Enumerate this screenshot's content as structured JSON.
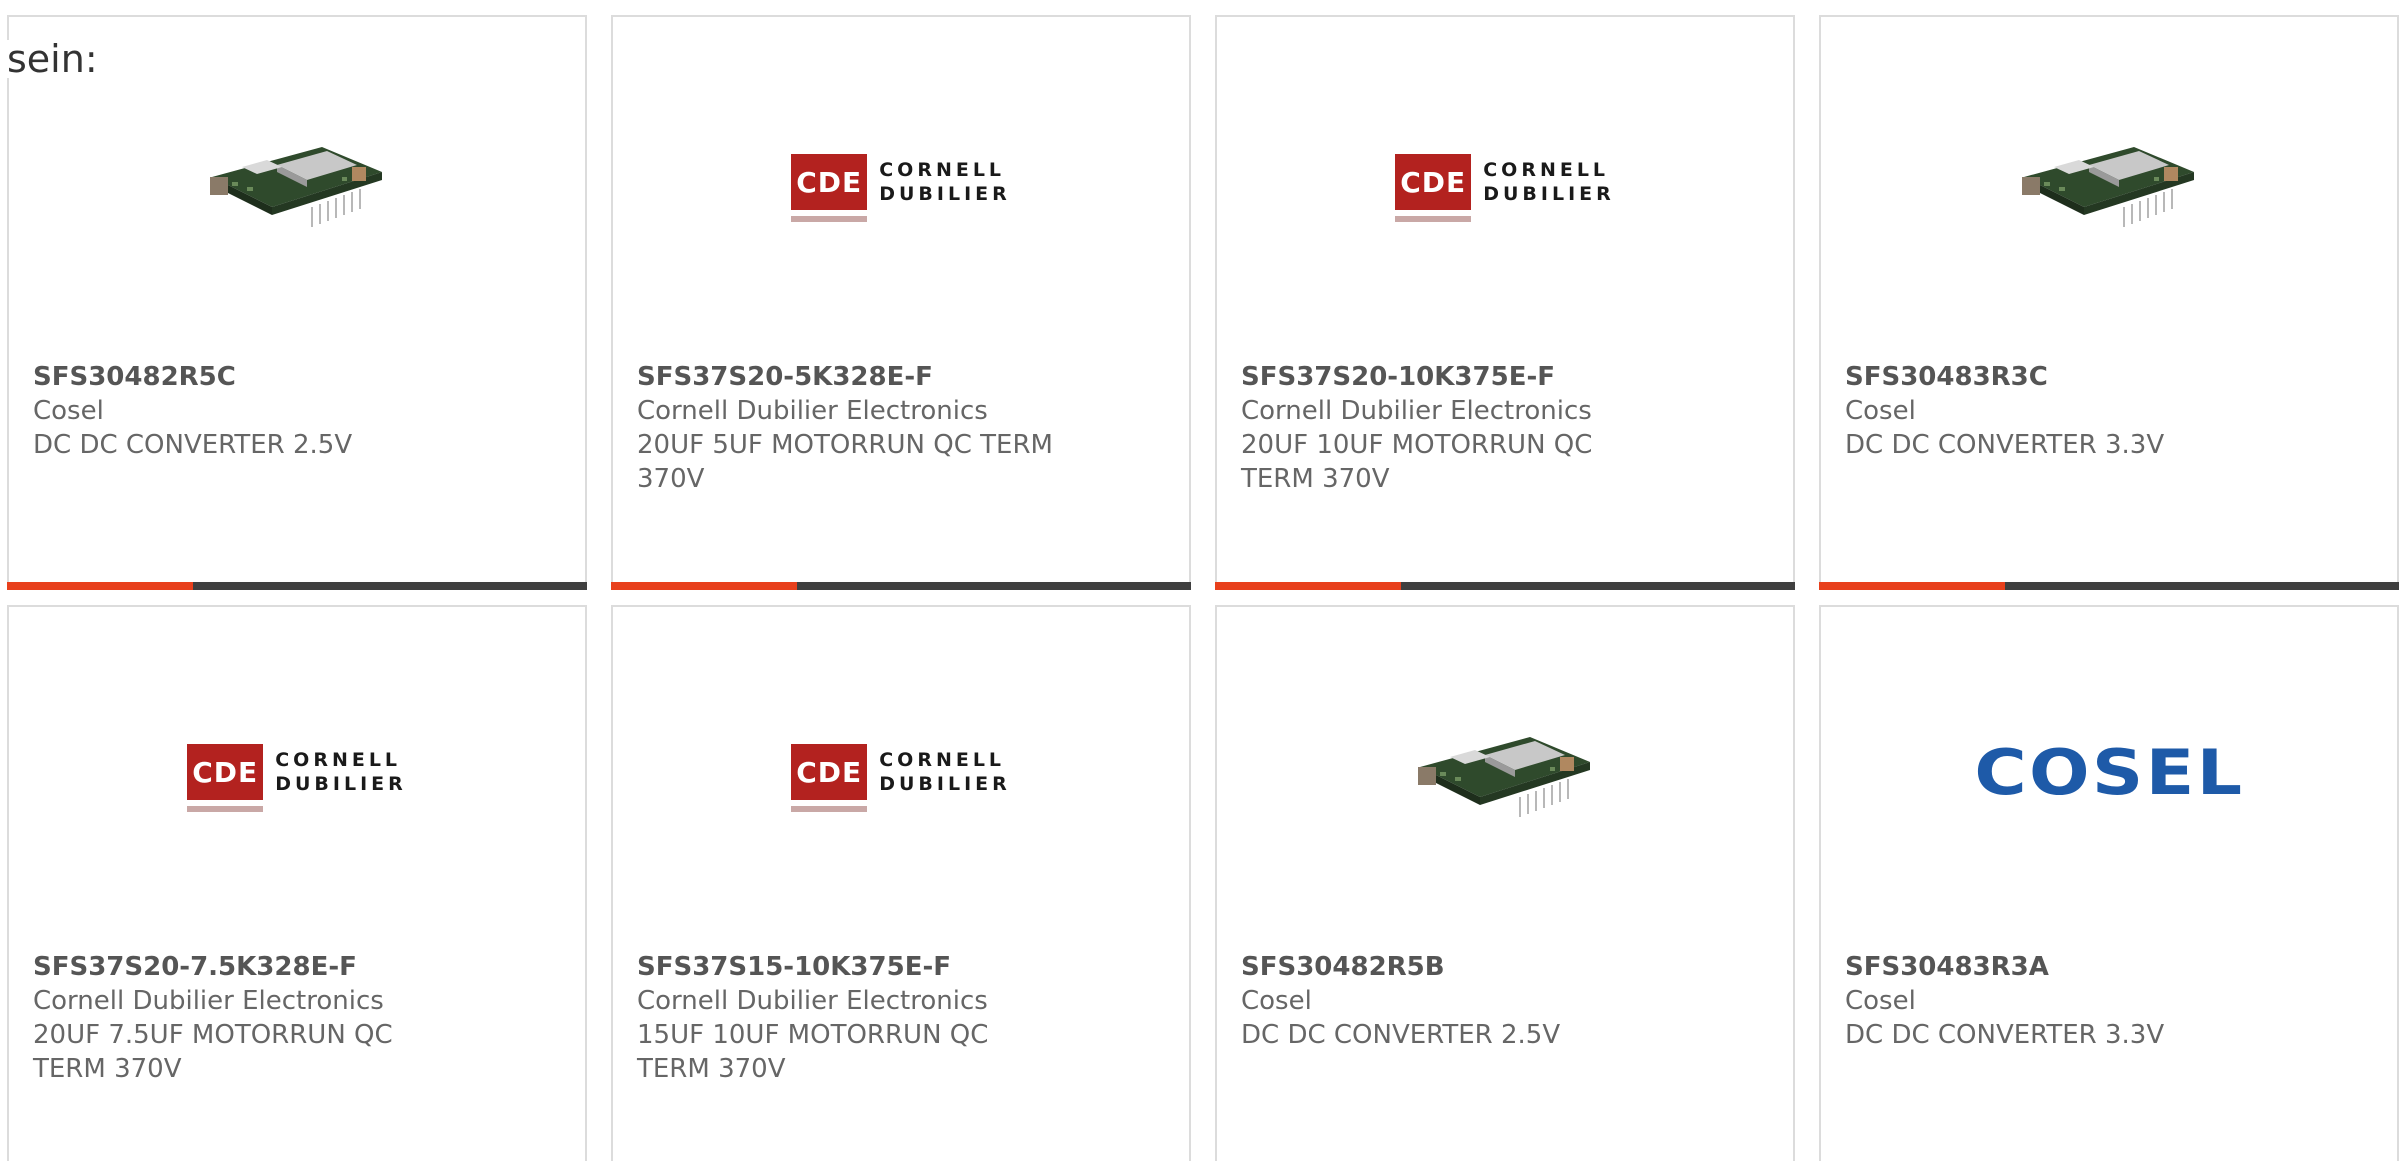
{
  "intro": {
    "text": "sein:"
  },
  "products": [
    {
      "part_number": "SFS30482R5C",
      "manufacturer": "Cosel",
      "description": "DC DC CONVERTER 2.5V",
      "image": "dc-converter-board-image",
      "progress": 0.32
    },
    {
      "part_number": "SFS37S20-5K328E-F",
      "manufacturer": "Cornell Dubilier Electronics",
      "description": "20UF 5UF MOTORRUN QC TERM 370V",
      "image": "cornell-dubilier-logo",
      "logo_mark": "CDE",
      "logo_words": [
        "CORNELL",
        "DUBILIER"
      ],
      "progress": 0.32
    },
    {
      "part_number": "SFS37S20-10K375E-F",
      "manufacturer": "Cornell Dubilier Electronics",
      "description": "20UF 10UF MOTORRUN QC TERM 370V",
      "image": "cornell-dubilier-logo",
      "logo_mark": "CDE",
      "logo_words": [
        "CORNELL",
        "DUBILIER"
      ],
      "progress": 0.32
    },
    {
      "part_number": "SFS30483R3C",
      "manufacturer": "Cosel",
      "description": "DC DC CONVERTER 3.3V",
      "image": "dc-converter-board-image",
      "progress": 0.32
    },
    {
      "part_number": "SFS37S20-7.5K328E-F",
      "manufacturer": "Cornell Dubilier Electronics",
      "description": "20UF 7.5UF MOTORRUN QC TERM 370V",
      "image": "cornell-dubilier-logo",
      "logo_mark": "CDE",
      "logo_words": [
        "CORNELL",
        "DUBILIER"
      ]
    },
    {
      "part_number": "SFS37S15-10K375E-F",
      "manufacturer": "Cornell Dubilier Electronics",
      "description": "15UF 10UF MOTORRUN QC TERM 370V",
      "image": "cornell-dubilier-logo",
      "logo_mark": "CDE",
      "logo_words": [
        "CORNELL",
        "DUBILIER"
      ]
    },
    {
      "part_number": "SFS30482R5B",
      "manufacturer": "Cosel",
      "description": "DC DC CONVERTER 2.5V",
      "image": "dc-converter-board-image"
    },
    {
      "part_number": "SFS30483R3A",
      "manufacturer": "Cosel",
      "description": "DC DC CONVERTER 3.3V",
      "image": "cosel-logo",
      "logo_text": "COSEL"
    }
  ],
  "colors": {
    "progress_fill": "#e8401c",
    "progress_track": "#3f3f3f",
    "cde_red": "#b3221f",
    "cosel_blue": "#1e5aa8"
  }
}
